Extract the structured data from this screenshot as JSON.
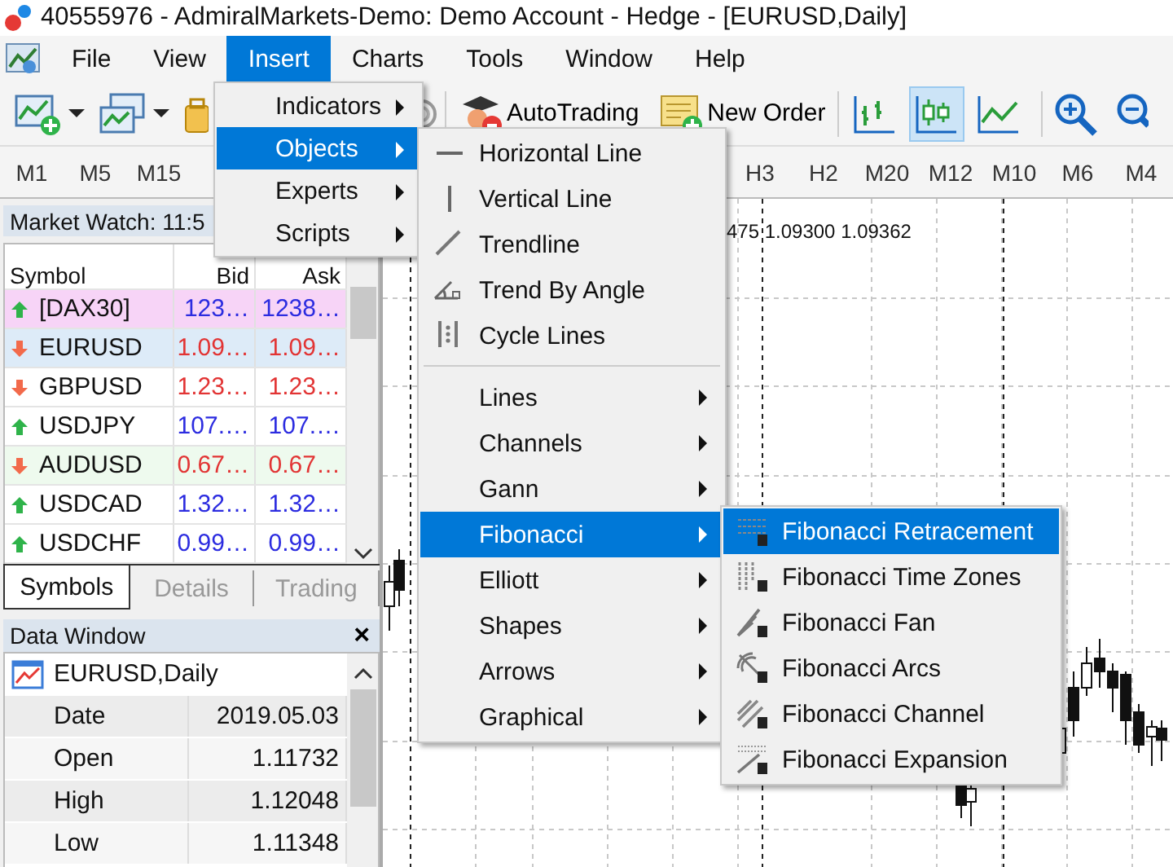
{
  "window": {
    "title": "40555976 - AdmiralMarkets-Demo: Demo Account - Hedge - [EURUSD,Daily]"
  },
  "menu_bar": [
    {
      "label": "File",
      "selected": false
    },
    {
      "label": "View",
      "selected": false
    },
    {
      "label": "Insert",
      "selected": true
    },
    {
      "label": "Charts",
      "selected": false
    },
    {
      "label": "Tools",
      "selected": false
    },
    {
      "label": "Window",
      "selected": false
    },
    {
      "label": "Help",
      "selected": false
    }
  ],
  "toolbar": {
    "buttons": [
      {
        "label": "AutoTrading"
      },
      {
        "label": "New Order"
      }
    ],
    "chart_types": [
      {
        "selected": false
      },
      {
        "selected": true
      },
      {
        "selected": false
      }
    ]
  },
  "timeframes": {
    "left": [
      "M1",
      "M5",
      "M15"
    ],
    "right": [
      "H3",
      "H2",
      "M20",
      "M12",
      "M10",
      "M6",
      "M4"
    ]
  },
  "market_watch": {
    "title": "Market Watch: 11:5",
    "columns": [
      "Symbol",
      "Bid",
      "Ask"
    ],
    "rows": [
      {
        "symbol": "[DAX30]",
        "kind": "up",
        "bid": "123…",
        "ask": "1238…",
        "color": "#f7d4f7"
      },
      {
        "symbol": "EURUSD",
        "kind": "down",
        "bid": "1.09…",
        "ask": "1.09…",
        "color": "#ddebf8"
      },
      {
        "symbol": "GBPUSD",
        "kind": "down",
        "bid": "1.23…",
        "ask": "1.23…",
        "color": "#ffffff"
      },
      {
        "symbol": "USDJPY",
        "kind": "up",
        "bid": "107.…",
        "ask": "107.…",
        "color": "#ffffff"
      },
      {
        "symbol": "AUDUSD",
        "kind": "down",
        "bid": "0.67…",
        "ask": "0.67…",
        "color": "#eefaee"
      },
      {
        "symbol": "USDCAD",
        "kind": "up",
        "bid": "1.32…",
        "ask": "1.32…",
        "color": "#ffffff"
      },
      {
        "symbol": "USDCHF",
        "kind": "up",
        "bid": "0.99…",
        "ask": "0.99…",
        "color": "#ffffff"
      }
    ],
    "tabs": [
      {
        "label": "Symbols",
        "selected": true
      },
      {
        "label": "Details",
        "selected": false
      },
      {
        "label": "Trading",
        "selected": false
      }
    ]
  },
  "data_window": {
    "title": "Data Window",
    "close": "×",
    "chart": "EURUSD,Daily",
    "rows": [
      {
        "label": "Date",
        "value": "2019.05.03"
      },
      {
        "label": "Open",
        "value": "1.11732"
      },
      {
        "label": "High",
        "value": "1.12048"
      },
      {
        "label": "Low",
        "value": "1.11348"
      }
    ]
  },
  "chart": {
    "price_label": "475 1.09300 1.09362"
  },
  "menus": [
    {
      "items": [
        {
          "label": "Indicators",
          "kind": "submenu",
          "selected": false
        },
        {
          "label": "Objects",
          "kind": "submenu",
          "selected": true
        },
        {
          "label": "Experts",
          "kind": "submenu",
          "selected": false
        },
        {
          "label": "Scripts",
          "kind": "submenu",
          "selected": false
        }
      ]
    },
    {
      "items": [
        {
          "label": "Horizontal Line",
          "kind": "tool",
          "selected": false
        },
        {
          "label": "Vertical Line",
          "kind": "tool",
          "selected": false
        },
        {
          "label": "Trendline",
          "kind": "tool",
          "selected": false
        },
        {
          "label": "Trend By Angle",
          "kind": "tool",
          "selected": false
        },
        {
          "label": "Cycle Lines",
          "kind": "tool",
          "selected": false
        },
        {
          "kind": "separator"
        },
        {
          "label": "Lines",
          "kind": "submenu",
          "selected": false
        },
        {
          "label": "Channels",
          "kind": "submenu",
          "selected": false
        },
        {
          "label": "Gann",
          "kind": "submenu",
          "selected": false
        },
        {
          "label": "Fibonacci",
          "kind": "submenu",
          "selected": true
        },
        {
          "label": "Elliott",
          "kind": "submenu",
          "selected": false
        },
        {
          "label": "Shapes",
          "kind": "submenu",
          "selected": false
        },
        {
          "label": "Arrows",
          "kind": "submenu",
          "selected": false
        },
        {
          "label": "Graphical",
          "kind": "submenu",
          "selected": false
        }
      ]
    },
    {
      "items": [
        {
          "label": "Fibonacci Retracement",
          "kind": "tool",
          "selected": true
        },
        {
          "label": "Fibonacci Time Zones",
          "kind": "tool",
          "selected": false
        },
        {
          "label": "Fibonacci Fan",
          "kind": "tool",
          "selected": false
        },
        {
          "label": "Fibonacci Arcs",
          "kind": "tool",
          "selected": false
        },
        {
          "label": "Fibonacci Channel",
          "kind": "tool",
          "selected": false
        },
        {
          "label": "Fibonacci Expansion",
          "kind": "tool",
          "selected": false
        }
      ]
    }
  ]
}
